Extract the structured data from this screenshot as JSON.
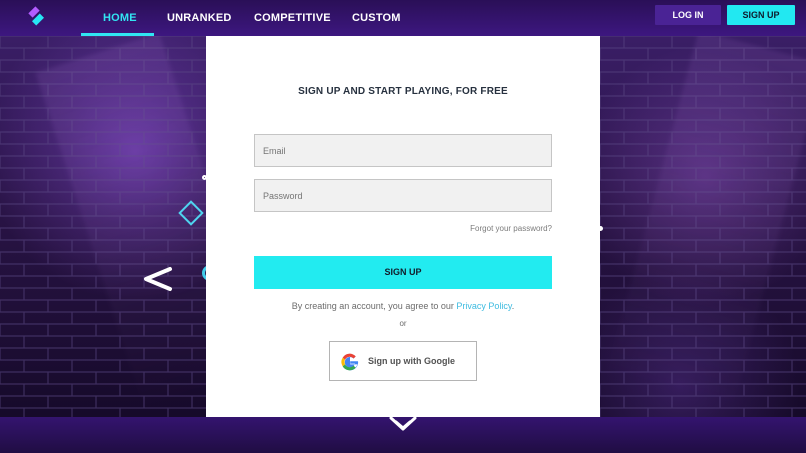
{
  "header": {
    "nav": [
      {
        "label": "HOME"
      },
      {
        "label": "UNRANKED"
      },
      {
        "label": "COMPETITIVE"
      },
      {
        "label": "CUSTOM"
      }
    ],
    "login_label": "LOG IN",
    "signup_label": "SIGN UP"
  },
  "signup_form": {
    "title": "SIGN UP AND START PLAYING, FOR FREE",
    "email_placeholder": "Email",
    "password_placeholder": "Password",
    "forgot_label": "Forgot your password?",
    "submit_label": "SIGN UP",
    "terms_text": "By creating an account, you agree to our ",
    "privacy_link": "Privacy Policy",
    "terms_suffix": ".",
    "or_label": "or",
    "google_label": "Sign up with Google"
  },
  "colors": {
    "topbar": "#3d1780",
    "accent": "#22ebf0",
    "link": "#3dbbe0"
  },
  "icons": {
    "logo": "logo-icon",
    "carousel_prev": "chevron-left-icon",
    "google": "google-icon",
    "scroll_down": "chevron-down-icon"
  }
}
